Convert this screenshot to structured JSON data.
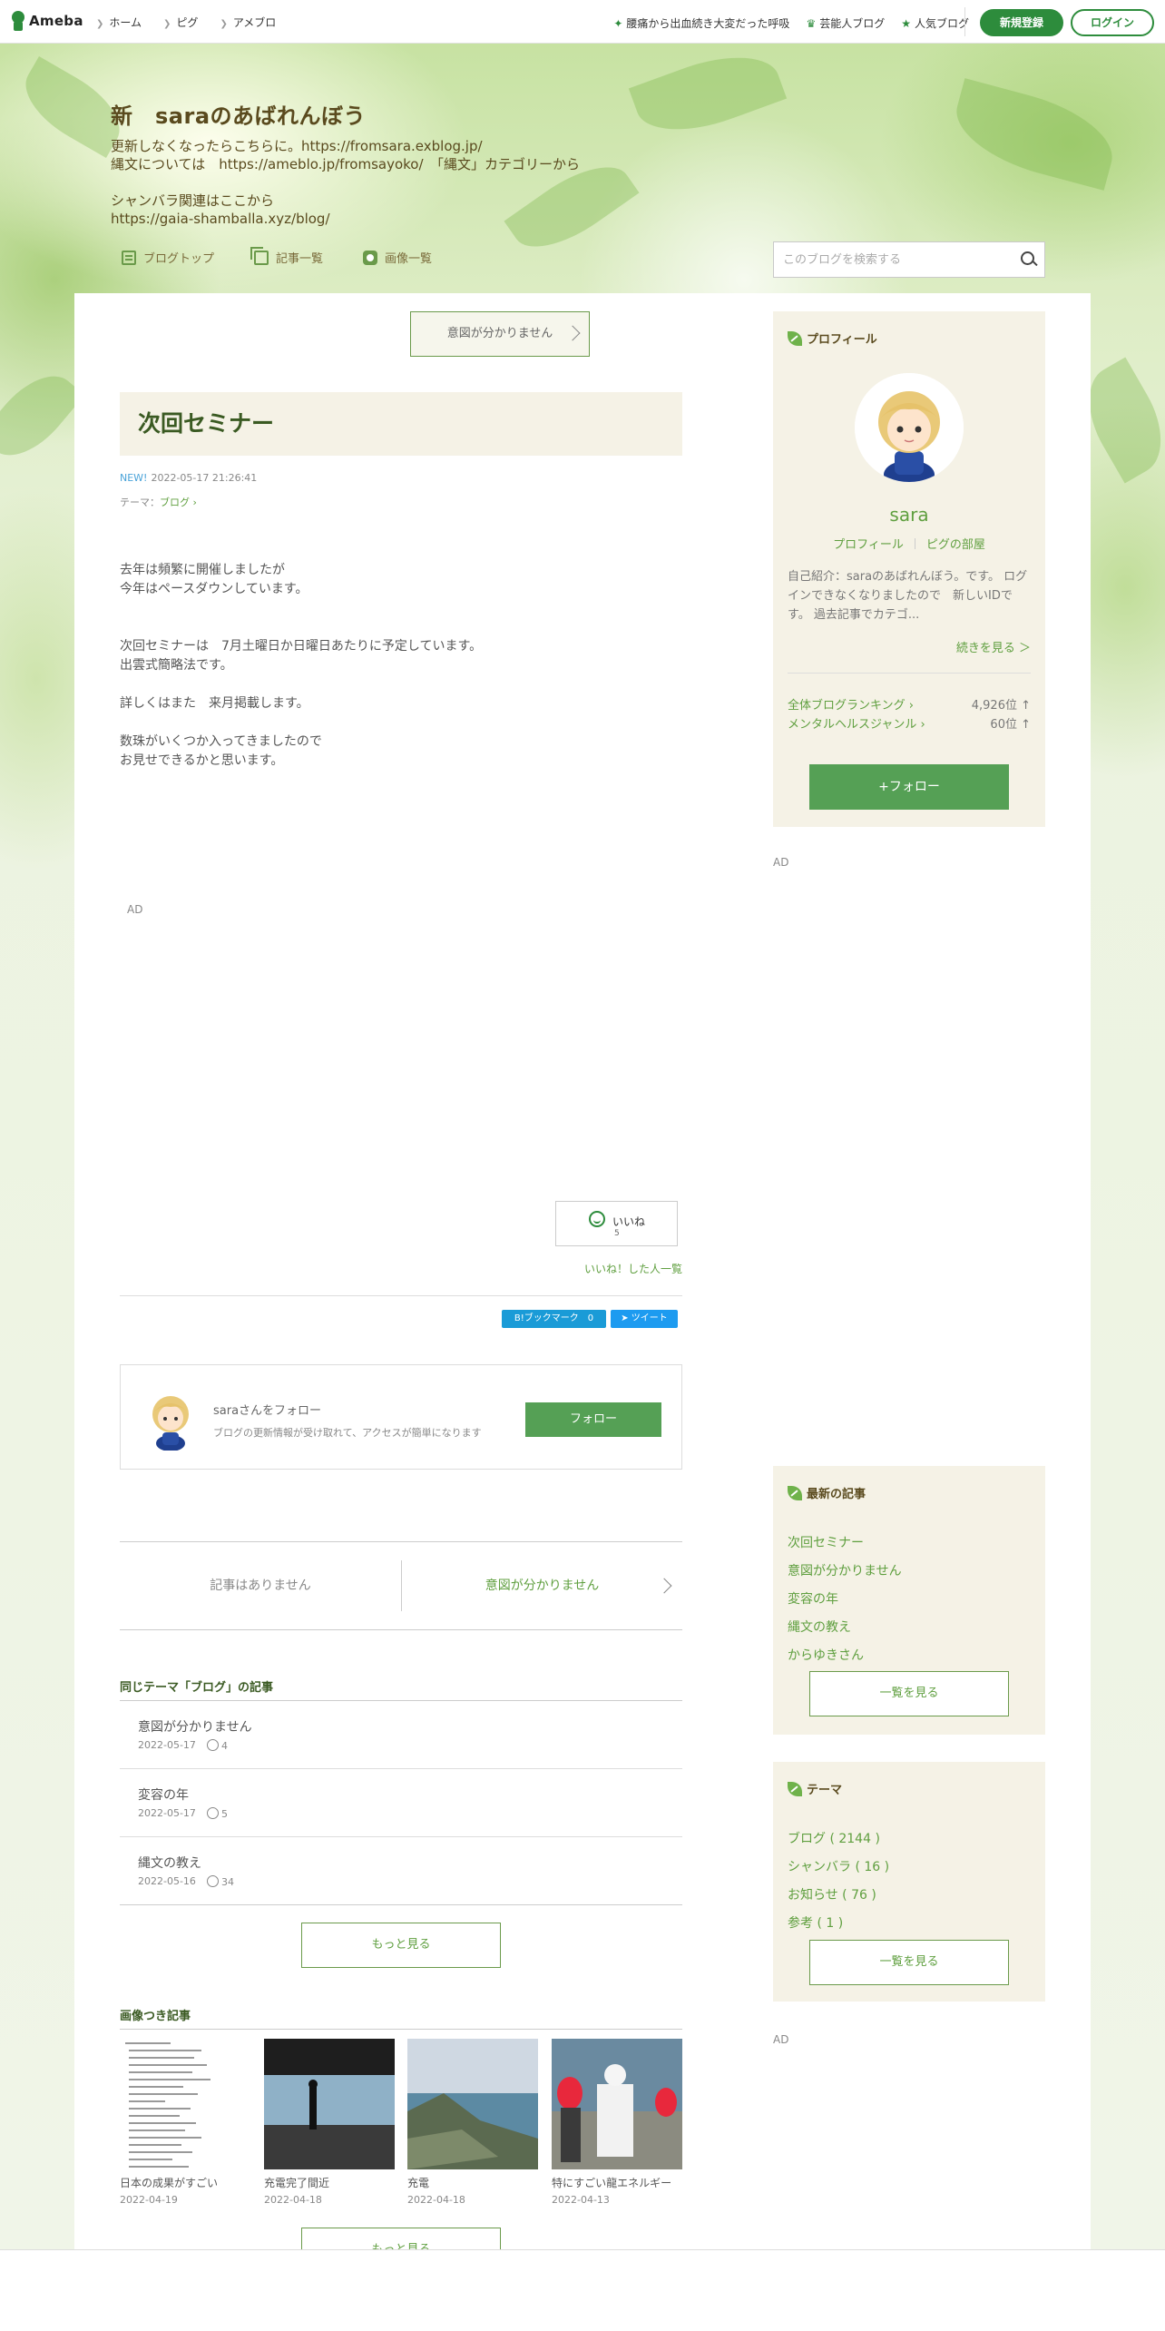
{
  "global_header": {
    "logo": "Ameba",
    "nav": [
      "ホーム",
      "ピグ",
      "アメブロ"
    ],
    "right_links": [
      {
        "icon": "sparkle-icon",
        "label": "腰痛から出血続き大変だった呼吸"
      },
      {
        "icon": "crown-icon",
        "label": "芸能人ブログ"
      },
      {
        "icon": "star-icon",
        "label": "人気ブログ"
      }
    ],
    "register_label": "新規登録",
    "login_label": "ログイン"
  },
  "blog": {
    "title": "新　saraのあばれんぼう",
    "description_lines": [
      "更新しなくなったらこちらに。https://fromsara.exblog.jp/",
      "縄文については　https://ameblo.jp/fromsayoko/　「縄文」カテゴリーから",
      "",
      "シャンバラ関連はここから",
      "https://gaia-shamballa.xyz/blog/"
    ],
    "nav": [
      "ブログトップ",
      "記事一覧",
      "画像一覧"
    ],
    "search_placeholder": "このブログを検索する"
  },
  "entry": {
    "prev_label": "意図が分かりません",
    "title": "次回セミナー",
    "new_label": "NEW!",
    "datetime": "2022-05-17 21:26:41",
    "theme_prefix": "テーマ：",
    "theme": "ブログ",
    "body": [
      "去年は頻繁に開催しましたが",
      "今年はペースダウンしています。",
      "",
      "",
      "次回セミナーは　7月土曜日か日曜日あたりに予定しています。",
      "出雲式簡略法です。",
      "",
      "詳しくはまた　来月掲載します。",
      "",
      "数珠がいくつか入ってきましたので",
      "お見せできるかと思います。"
    ],
    "ad_label": "AD",
    "like_label": "いいね",
    "like_count": "5",
    "likers_label": "いいね！した人一覧",
    "bookmark_label": "B!ブックマーク　0",
    "tweet_label": "ツイート"
  },
  "follow_card": {
    "name": "saraさんをフォロー",
    "sub": "ブログの更新情報が受け取れて、アクセスが簡単になります",
    "button": "フォロー"
  },
  "pager": {
    "prev": "記事はありません",
    "next": "意図が分かりません"
  },
  "related": {
    "heading": "同じテーマ「ブログ」の記事",
    "items": [
      {
        "title": "意図が分かりません",
        "date": "2022-05-17",
        "likes": "4"
      },
      {
        "title": "変容の年",
        "date": "2022-05-17",
        "likes": "5"
      },
      {
        "title": "縄文の教え",
        "date": "2022-05-16",
        "likes": "34"
      }
    ],
    "more": "もっと見る"
  },
  "image_articles": {
    "heading": "画像つき記事",
    "items": [
      {
        "caption": "日本の成果がすごい",
        "date": "2022-04-19"
      },
      {
        "caption": "充電完了間近",
        "date": "2022-04-18"
      },
      {
        "caption": "充電",
        "date": "2022-04-18"
      },
      {
        "caption": "特にすごい龍エネルギー",
        "date": "2022-04-13"
      }
    ],
    "more": "もっと見る"
  },
  "sidebar": {
    "profile": {
      "heading": "プロフィール",
      "name": "sara",
      "link1": "プロフィール",
      "link2": "ピグの部屋",
      "intro": "自己紹介：saraのあばれんぼう。です。 ログインできなくなりましたので　新しいIDです。 過去記事でカテゴ...",
      "more": "続きを見る ＞",
      "rank1_label": "全体ブログランキング",
      "rank1_value": "4,926位 ↑",
      "rank2_label": "メンタルヘルスジャンル",
      "rank2_value": "60位 ↑",
      "follow": "+フォロー"
    },
    "ad_label": "AD",
    "latest": {
      "heading": "最新の記事",
      "items": [
        "次回セミナー",
        "意図が分かりません",
        "変容の年",
        "縄文の教え",
        "からゆきさん"
      ],
      "button": "一覧を見る"
    },
    "themes": {
      "heading": "テーマ",
      "items": [
        "ブログ ( 2144 )",
        "シャンバラ ( 16 )",
        "お知らせ ( 76 )",
        "参考 ( 1 )"
      ],
      "button": "一覧を見る"
    }
  }
}
